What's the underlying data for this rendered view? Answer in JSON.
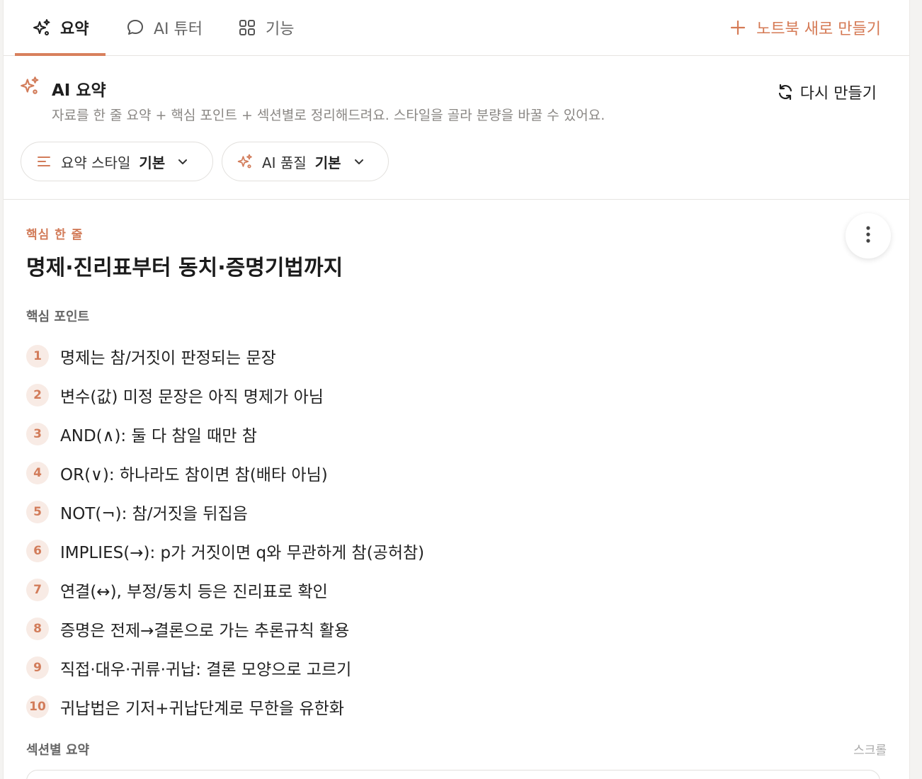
{
  "tabs": [
    {
      "label": "요약",
      "icon": "sparkles-icon",
      "active": true
    },
    {
      "label": "AI 튜터",
      "icon": "chat-bubble-icon",
      "active": false
    },
    {
      "label": "기능",
      "icon": "grid-icon",
      "active": false
    }
  ],
  "new_note": {
    "label": "노트북 새로 만들기",
    "icon": "plus-icon"
  },
  "summary": {
    "title": "AI 요약",
    "description": "자료를 한 줄 요약 + 핵심 포인트 + 섹션별로 정리해드려요. 스타일을 골라 분량을 바꿀 수 있어요.",
    "regenerate_label": "다시 만들기"
  },
  "filters": {
    "style": {
      "label": "요약 스타일",
      "value": "기본"
    },
    "quality": {
      "label": "AI 품질",
      "value": "기본"
    }
  },
  "content": {
    "kicker": "핵심 한 줄",
    "headline": "명제·진리표부터 동치·증명기법까지",
    "points_label": "핵심 포인트",
    "points": [
      {
        "num": "1",
        "text": "명제는 참/거짓이 판정되는 문장"
      },
      {
        "num": "2",
        "text": "변수(값) 미정 문장은 아직 명제가 아님"
      },
      {
        "num": "3",
        "text": "AND(∧): 둘 다 참일 때만 참"
      },
      {
        "num": "4",
        "text": "OR(∨): 하나라도 참이면 참(배타 아님)"
      },
      {
        "num": "5",
        "text": "NOT(¬): 참/거짓을 뒤집음"
      },
      {
        "num": "6",
        "text": "IMPLIES(→): p가 거짓이면 q와 무관하게 참(공허참)"
      },
      {
        "num": "7",
        "text": "연결(↔), 부정/동치 등은 진리표로 확인"
      },
      {
        "num": "8",
        "text": "증명은 전제→결론으로 가는 추론규칙 활용"
      },
      {
        "num": "9",
        "text": "직접·대우·귀류·귀납: 결론 모양으로 고르기"
      },
      {
        "num": "10",
        "text": "귀납법은 기저+귀납단계로 무한을 유한화"
      }
    ],
    "sections_label": "섹션별 요약",
    "scroll_hint": "스크롤"
  },
  "colors": {
    "accent": "#d27c5a",
    "tab_underline": "#d8805d"
  }
}
